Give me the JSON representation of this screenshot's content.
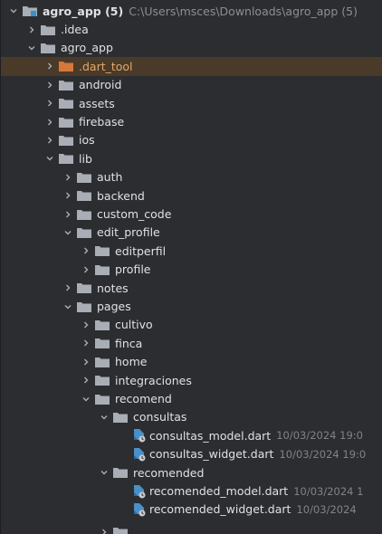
{
  "project": {
    "name": "agro_app (5)",
    "path": "C:\\Users\\msces\\Downloads\\agro_app (5)"
  },
  "tree": {
    "idea": ".idea",
    "agro_app": "agro_app",
    "dart_tool": ".dart_tool",
    "android": "android",
    "assets": "assets",
    "firebase": "firebase",
    "ios": "ios",
    "lib": "lib",
    "auth": "auth",
    "backend": "backend",
    "custom_code": "custom_code",
    "edit_profile": "edit_profile",
    "editperfil": "editperfil",
    "profile": "profile",
    "notes": "notes",
    "pages": "pages",
    "cultivo": "cultivo",
    "finca": "finca",
    "home": "home",
    "integraciones": "integraciones",
    "recomend": "recomend",
    "consultas": "consultas",
    "consultas_model": "consultas_model.dart",
    "consultas_model_meta": "10/03/2024 19:0",
    "consultas_widget": "consultas_widget.dart",
    "consultas_widget_meta": "10/03/2024 19:0",
    "recomended": "recomended",
    "recomended_model": "recomended_model.dart",
    "recomended_model_meta": "10/03/2024 1",
    "recomended_widget": "recomended_widget.dart",
    "recomended_widget_meta": "10/03/2024"
  },
  "colors": {
    "background": "#2b2d30",
    "folder": "#a9adb5",
    "excluded_folder": "#d4783c",
    "text": "#dfe1e5",
    "meta": "#7f838a"
  }
}
